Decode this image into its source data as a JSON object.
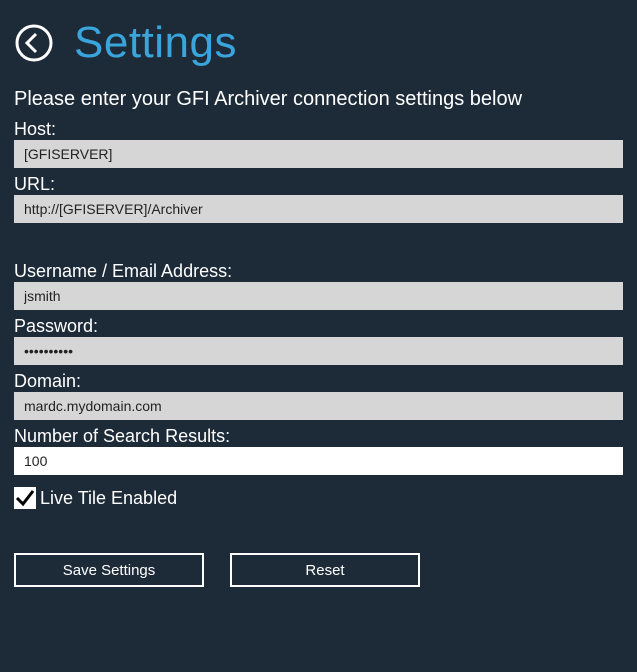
{
  "header": {
    "title": "Settings"
  },
  "instructions": "Please enter your GFI Archiver connection settings below",
  "fields": {
    "host": {
      "label": "Host:",
      "value": "[GFISERVER]"
    },
    "url": {
      "label": "URL:",
      "value": "http://[GFISERVER]/Archiver"
    },
    "username": {
      "label": "Username / Email Address:",
      "value": "jsmith"
    },
    "password": {
      "label": "Password:",
      "value": "••••••••••"
    },
    "domain": {
      "label": "Domain:",
      "value": "mardc.mydomain.com"
    },
    "results": {
      "label": "Number of Search Results:",
      "value": "100"
    }
  },
  "checkbox": {
    "label": "Live Tile Enabled",
    "checked": true
  },
  "buttons": {
    "save": "Save Settings",
    "reset": "Reset"
  }
}
